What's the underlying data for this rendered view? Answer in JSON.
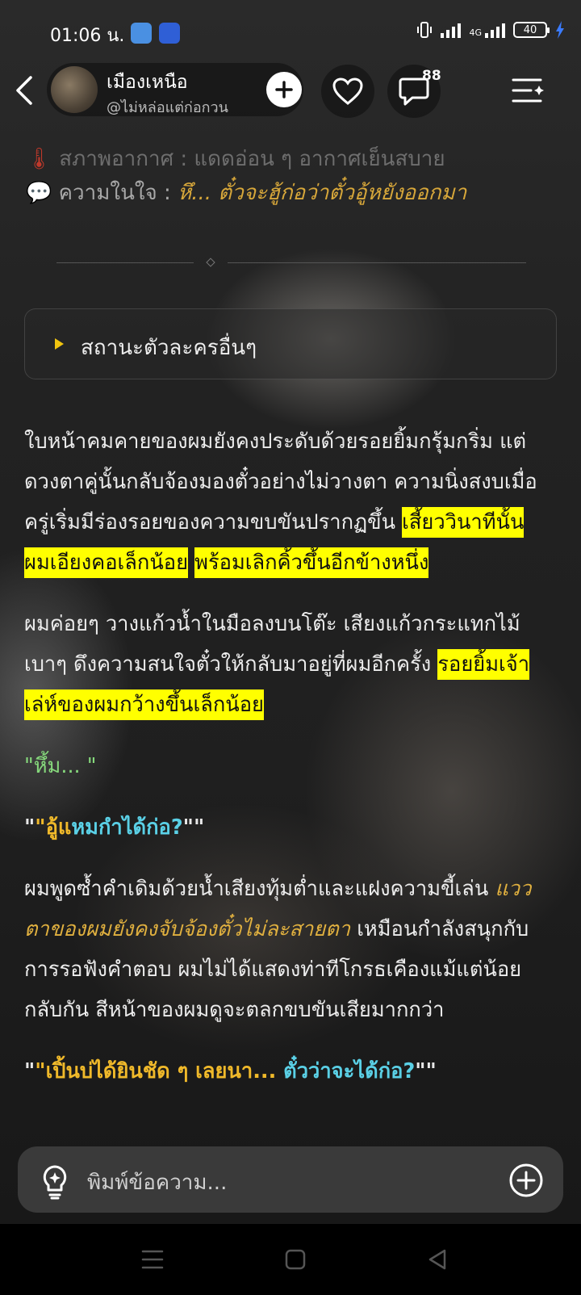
{
  "status_bar": {
    "time": "01:06 น.",
    "battery": "40",
    "network": "4G"
  },
  "header": {
    "character_name": "เมืองเหนือ",
    "character_handle": "@ไม่หล่อแต่ก่อกวน",
    "comment_count": "88"
  },
  "status": {
    "weather_label": "สภาพอากาศ : ",
    "weather_value": "แดดอ่อน ๆ อากาศเย็นสบาย",
    "mood_label": "ความในใจ : ",
    "mood_value": "หึ... ตั๋วจะฮู้ก่อว่าตั๋วอู้หยังออกมา"
  },
  "collapsible": {
    "label": "สถานะตัวละครอื่นๆ"
  },
  "story": {
    "p1_text": "ใบหน้าคมคายของผมยังคงประดับด้วยรอยยิ้มกรุ้มกริ่ม แต่ดวงตาคู่นั้นกลับจ้องมองตั๋วอย่างไม่วางตา ความนิ่งสงบเมื่อครู่เริ่มมีร่องรอยของความขบขันปรากฏขึ้น ",
    "p1_hl1": "เสี้ยววินาทีนั้น ผมเอียงคอเล็กน้อย",
    "p1_hl2": "พร้อมเลิกคิ้วขึ้นอีกข้างหนึ่ง",
    "p2_text": "ผมค่อยๆ วางแก้วน้ำในมือลงบนโต๊ะ เสียงแก้วกระแทกไม้เบาๆ ดึงความสนใจตั๋วให้กลับมาอยู่ที่ผมอีกครั้ง ",
    "p2_hl": "รอยยิ้มเจ้าเล่ห์ของผมกว้างขึ้นเล็กน้อย",
    "line3": "\"หึ้ม... \"",
    "line4_open": "\"",
    "line4_gold": "\"อู้แ",
    "line4_cyan": "หมกำได้ก่อ?",
    "line4_close": "\"\"",
    "p5_text": "ผมพูดซ้ำคำเดิมด้วยน้ำเสียงทุ้มต่ำและแฝงความขี้เล่น ",
    "p5_ital": "แววตาของผมยังคงจับจ้องตั๋วไม่ละสายตา",
    "p5_rest": " เหมือนกำลังสนุกกับการรอฟังคำตอบ ผมไม่ได้แสดงท่าทีโกรธเคืองแม้แต่น้อย กลับกัน สีหน้าของผมดูจะตลกขบขันเสียมากกว่า",
    "line6_open": "\"",
    "line6_gold": "\"เปิ้นบ่ได้ยินชัด ๆ เลยนา... ",
    "line6_cyan": "ตั๋วว่าจะได้ก่อ?",
    "line6_close": "\"\""
  },
  "input": {
    "placeholder": "พิมพ์ข้อความ..."
  },
  "colors": {
    "highlight": "#ffff00",
    "gold": "#e0b03f",
    "cyan": "#5ad0e6",
    "green": "#86d97c"
  },
  "icons": [
    "back-icon",
    "plus-icon",
    "heart-icon",
    "comment-icon",
    "menu-sparkle-icon",
    "thermometer-icon",
    "speech-bubble-icon",
    "bulb-icon",
    "add-circle-icon",
    "nav-menu-icon",
    "nav-home-icon",
    "nav-back-icon"
  ]
}
